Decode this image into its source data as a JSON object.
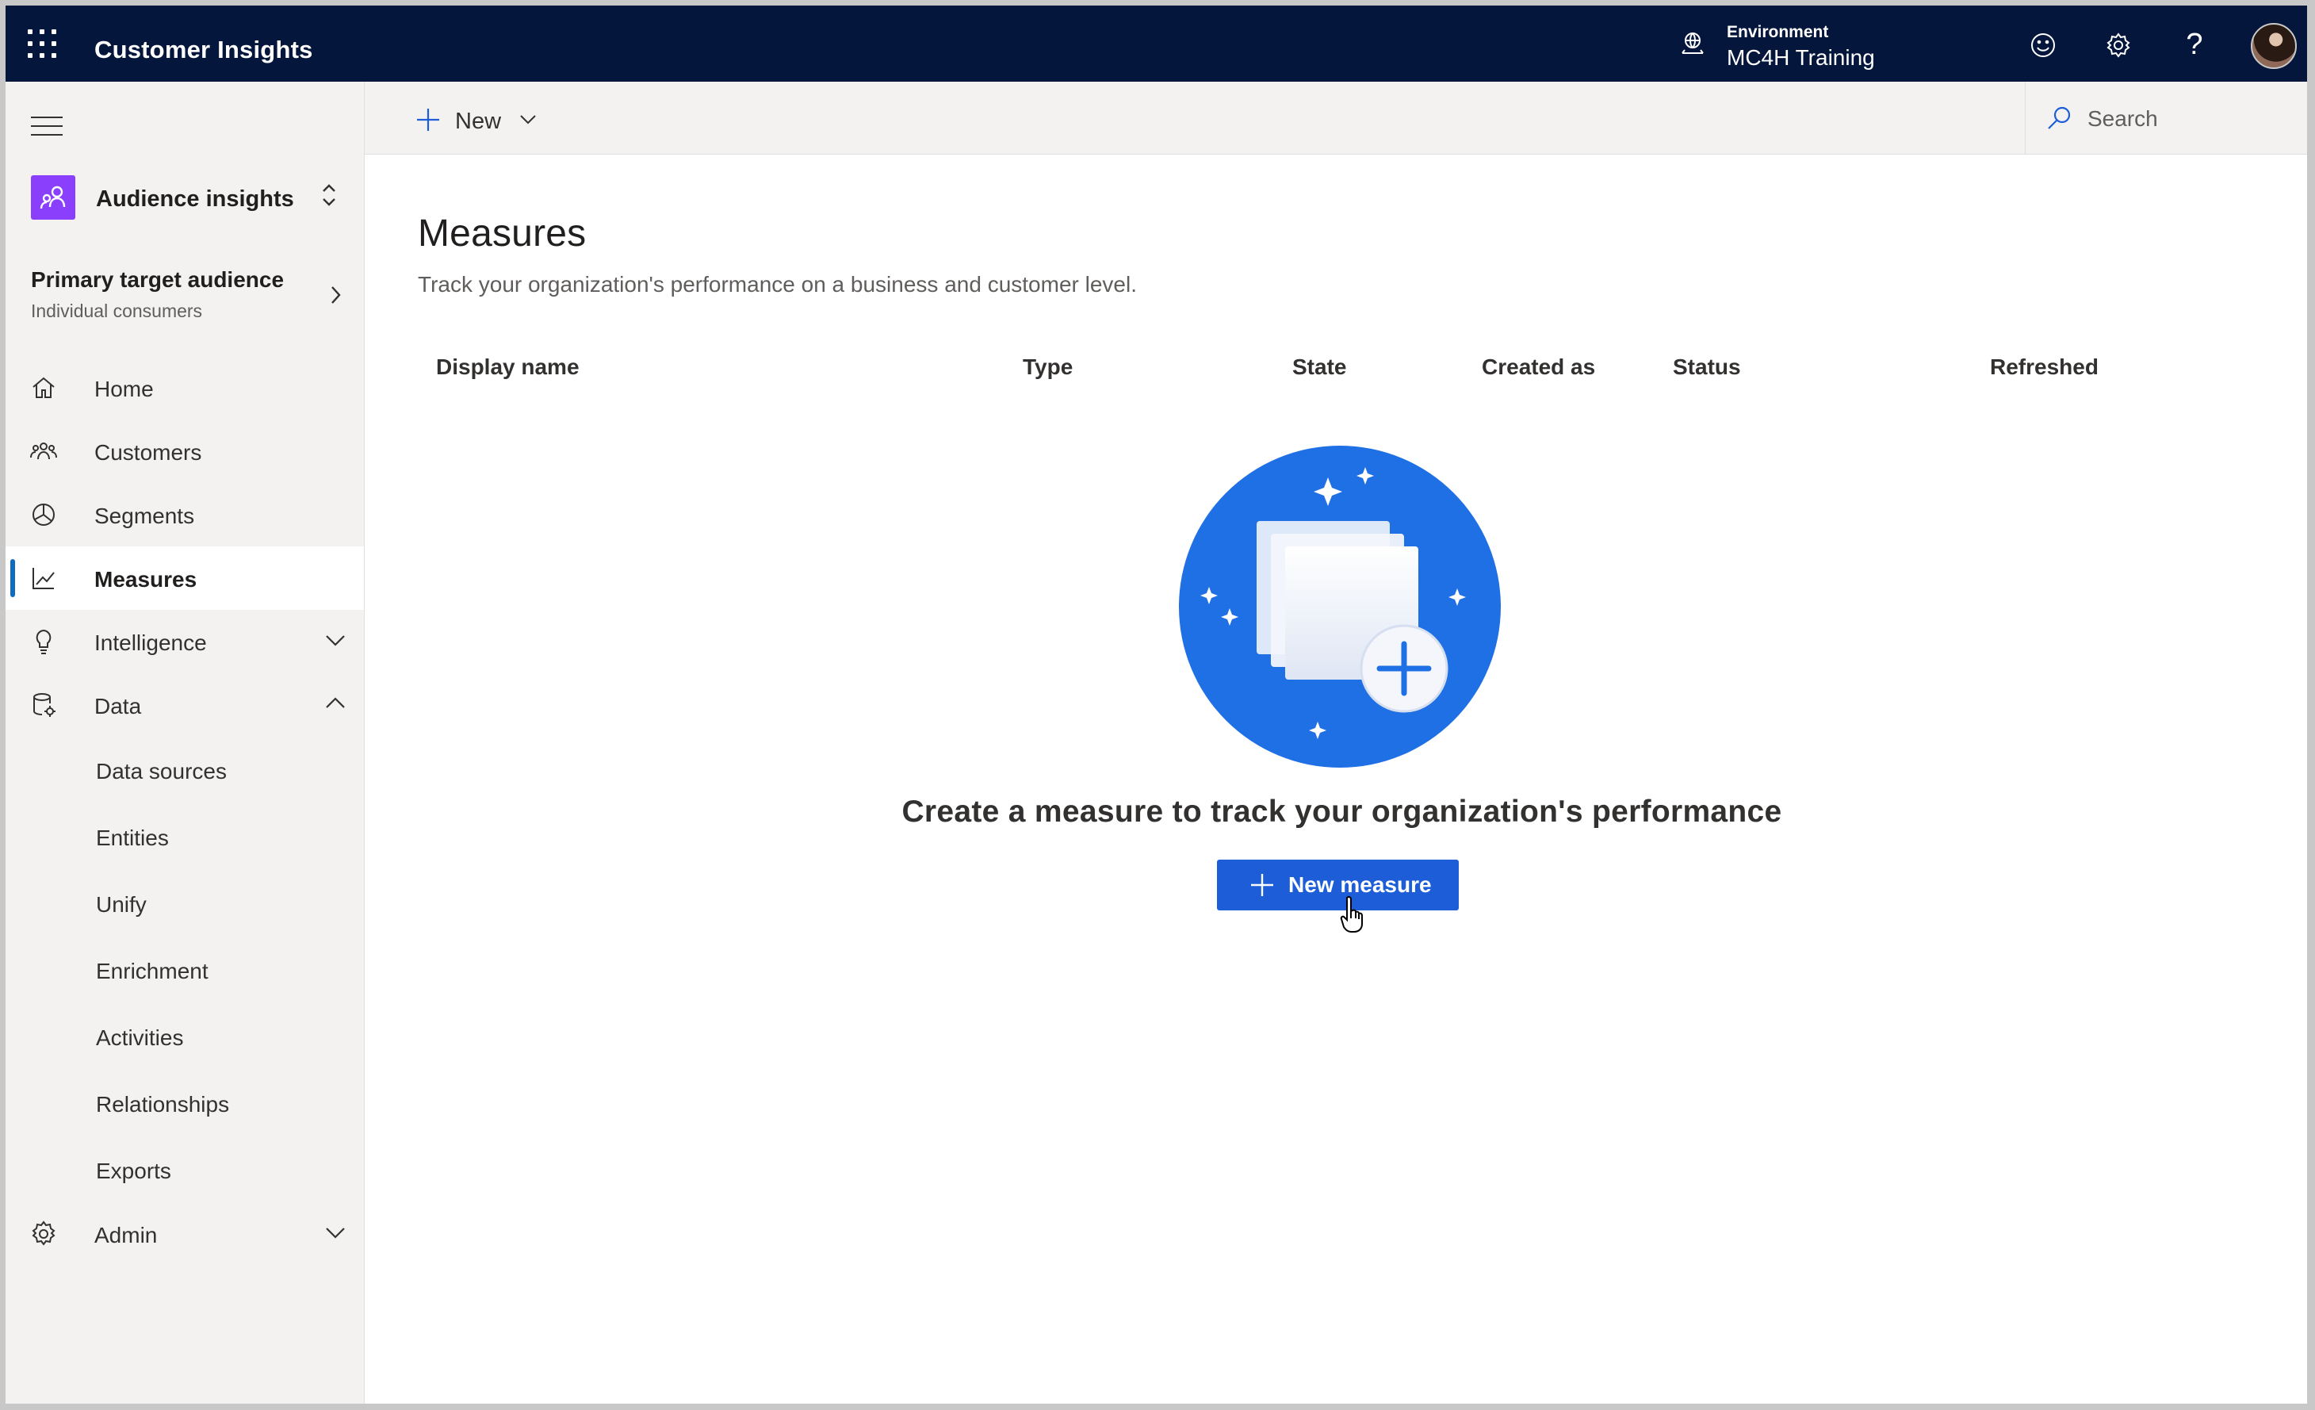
{
  "app": {
    "title": "Customer Insights"
  },
  "environment": {
    "label": "Environment",
    "value": "MC4H Training"
  },
  "topbar_icons": [
    "waffle-icon",
    "environment-icon",
    "smile-icon",
    "gear-icon",
    "help-icon",
    "avatar"
  ],
  "topbar": {
    "help_glyph": "?"
  },
  "sidebar": {
    "switcher": {
      "label": "Audience insights"
    },
    "audience": {
      "title": "Primary target audience",
      "subtitle": "Individual consumers"
    },
    "items": [
      {
        "label": "Home",
        "icon": "home-icon"
      },
      {
        "label": "Customers",
        "icon": "customers-icon"
      },
      {
        "label": "Segments",
        "icon": "segments-icon"
      },
      {
        "label": "Measures",
        "icon": "measures-icon",
        "active": true
      },
      {
        "label": "Intelligence",
        "icon": "lightbulb-icon",
        "expandable": "collapsed"
      },
      {
        "label": "Data",
        "icon": "data-icon",
        "expandable": "expanded"
      }
    ],
    "data_children": [
      "Data sources",
      "Entities",
      "Unify",
      "Enrichment",
      "Activities",
      "Relationships",
      "Exports"
    ],
    "admin": {
      "label": "Admin",
      "icon": "gear-icon",
      "expandable": "collapsed"
    }
  },
  "commandbar": {
    "new_label": "New",
    "search_placeholder": "Search"
  },
  "main": {
    "title": "Measures",
    "description": "Track your organization's performance on a business and customer level.",
    "columns": [
      "Display name",
      "Type",
      "State",
      "Created as",
      "Status",
      "Refreshed"
    ],
    "empty_state": {
      "title": "Create a measure to track your organization's performance",
      "button_label": "New measure"
    }
  },
  "colors": {
    "topbar_bg": "#04163b",
    "sidebar_bg": "#f3f2f1",
    "accent": "#1d5ed8",
    "illustration": "#1f6fe5",
    "switcher_icon": "#8a3ffc"
  }
}
